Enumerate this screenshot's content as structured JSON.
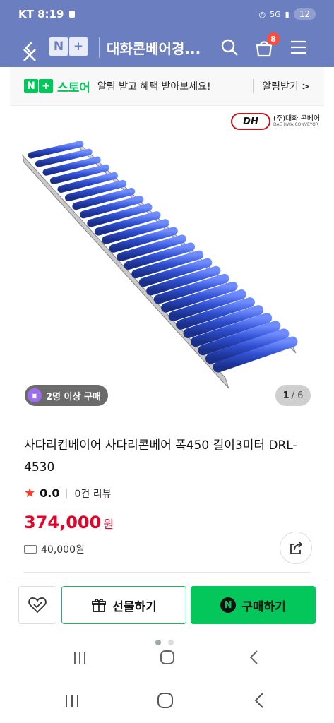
{
  "status_bar": {
    "carrier_time": "KT 8:19",
    "battery": "12",
    "network": "5G"
  },
  "header": {
    "logo_n": "N",
    "logo_plus": "+",
    "store_name": "대화콘베어경...",
    "cart_count": "8"
  },
  "notification_banner": {
    "logo_n": "N",
    "logo_plus": "+",
    "store_label": "스토어",
    "message": "알림 받고 혜택 받아보세요!",
    "action": "알림받기 >"
  },
  "brand": {
    "mark": "DH",
    "name": "(주)대화 콘베어",
    "sub": "DAE HWA CONVEYOR"
  },
  "gallery": {
    "group_buy_badge": "2명 이상 구매",
    "current_page": "1",
    "total_pages": "/ 6"
  },
  "product": {
    "title": "사다리컨베이어 사다리콘베어 폭450 길이3미터 DRL-4530",
    "rating": "0.0",
    "review_count": "0건 리뷰",
    "price": "374,000",
    "price_unit": "원",
    "shipping_fee": "40,000원"
  },
  "actions": {
    "gift_label": "선물하기",
    "buy_label": "구매하기",
    "buy_icon_letter": "N"
  },
  "colors": {
    "header_bg": "#6b7ec0",
    "naver_green": "#03c75a",
    "price_red": "#e0062b",
    "roller_blue": "#2f4fd0"
  }
}
